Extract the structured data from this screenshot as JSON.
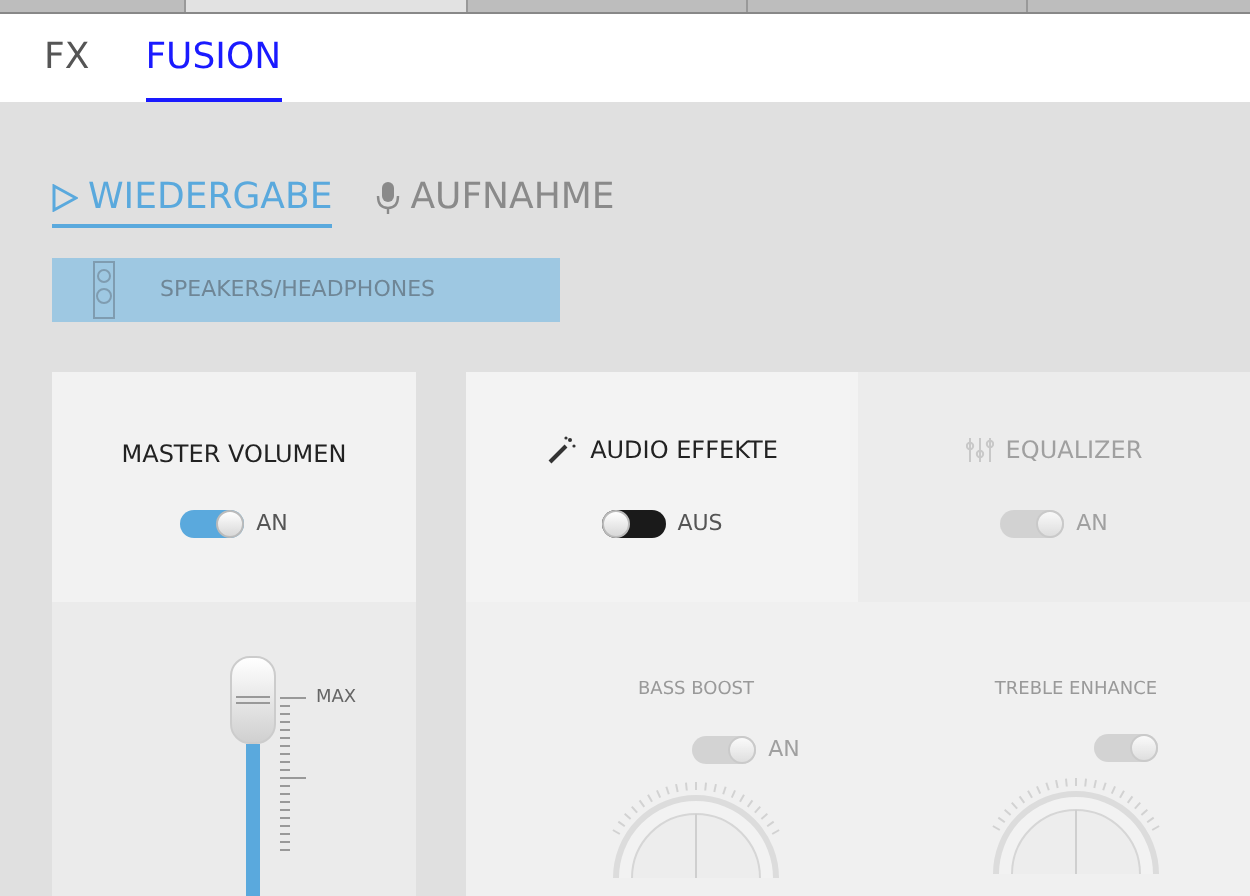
{
  "tabs": [
    {
      "label": "FX",
      "selected": false
    },
    {
      "label": "FUSION",
      "selected": true
    }
  ],
  "modes": [
    {
      "label": "WIEDERGABE",
      "kind": "playback",
      "selected": true
    },
    {
      "label": "AUFNAHME",
      "kind": "recording",
      "selected": false
    }
  ],
  "device": {
    "label": "SPEAKERS/HEADPHONES",
    "selected": true
  },
  "master": {
    "title": "MASTER VOLUMEN",
    "toggle": {
      "on": true,
      "label": "AN"
    },
    "slider": {
      "label": "MAX",
      "level": 1
    }
  },
  "sections": [
    {
      "title": "AUDIO EFFEKTE",
      "kind": "effects",
      "on": false,
      "label": "AUS",
      "disabled": false
    },
    {
      "title": "EQUALIZER",
      "kind": "equalizer",
      "on": true,
      "label": "AN",
      "disabled": true
    }
  ],
  "effects": [
    {
      "title": "BASS BOOST",
      "on": true,
      "label": "AN",
      "disabled": true
    },
    {
      "title": "TREBLE ENHANCE",
      "on": true,
      "disabled": true
    }
  ]
}
